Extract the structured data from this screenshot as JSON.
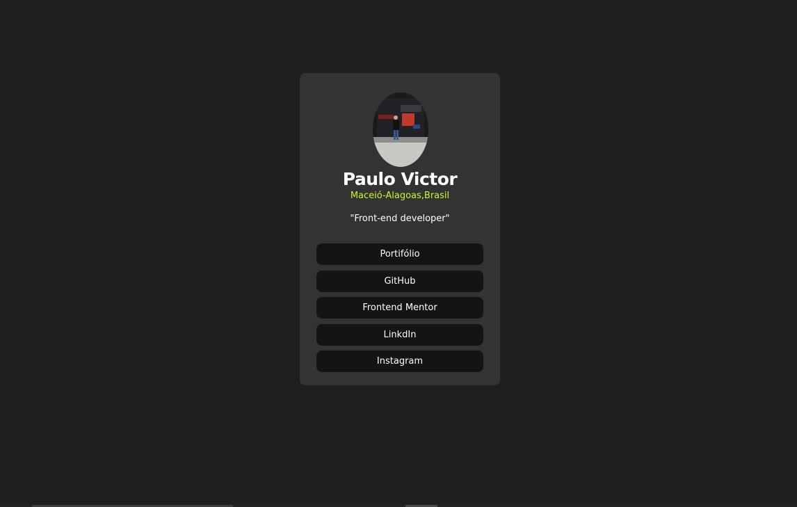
{
  "profile": {
    "name": "Paulo Victor",
    "location": "Maceió-Alagoas,Brasil",
    "bio": "\"Front-end developer\""
  },
  "links": [
    {
      "label": "Portifólio"
    },
    {
      "label": "GitHub"
    },
    {
      "label": "Frontend Mentor"
    },
    {
      "label": "LinkdIn"
    },
    {
      "label": "Instagram"
    }
  ],
  "colors": {
    "background": "#1f1f1f",
    "card": "#333333",
    "button": "#141414",
    "accent": "#c4f82a",
    "text": "#ffffff"
  }
}
